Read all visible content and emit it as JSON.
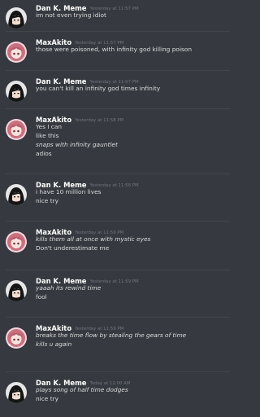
{
  "messages": [
    {
      "author": "Dan K. Meme",
      "avatar": "dan-avatar",
      "timestamp": "Yesterday at 11:57 PM",
      "lines": [
        {
          "text": "im not even trying idiot",
          "italic": false
        }
      ]
    },
    {
      "author": "MaxAkito",
      "avatar": "max-avatar",
      "timestamp": "Yesterday at 11:57 PM",
      "lines": [
        {
          "text": "those were poisoned, with infinity god killing poison",
          "italic": false
        }
      ]
    },
    {
      "author": "Dan K. Meme",
      "avatar": "dan-avatar",
      "timestamp": "Yesterday at 11:57 PM",
      "lines": [
        {
          "text": "you can't kill an infinity god times infinity",
          "italic": false
        }
      ]
    },
    {
      "author": "MaxAkito",
      "avatar": "max-avatar",
      "timestamp": "Yesterday at 11:58 PM",
      "lines": [
        {
          "text": "Yes I can",
          "italic": false
        },
        {
          "text": "like this",
          "italic": false
        },
        {
          "text": "snaps with infinity gauntlet",
          "italic": true
        },
        {
          "text": "adios",
          "italic": false
        }
      ]
    },
    {
      "author": "Dan K. Meme",
      "avatar": "dan-avatar",
      "timestamp": "Yesterday at 11:58 PM",
      "lines": [
        {
          "text": "i have 10 million lives",
          "italic": false
        },
        {
          "text": "nice try",
          "italic": false
        }
      ]
    },
    {
      "author": "MaxAkito",
      "avatar": "max-avatar",
      "timestamp": "Yesterday at 11:59 PM",
      "lines": [
        {
          "text": "kills them all at once with mystic eyes",
          "italic": true
        },
        {
          "text": "Don't underestimate me",
          "italic": false
        }
      ]
    },
    {
      "author": "Dan K. Meme",
      "avatar": "dan-avatar",
      "timestamp": "Yesterday at 11:59 PM",
      "lines": [
        {
          "text": "yaaah its rewind time",
          "italic": true
        },
        {
          "text": "fool",
          "italic": false
        }
      ]
    },
    {
      "author": "MaxAkito",
      "avatar": "max-avatar",
      "timestamp": "Yesterday at 11:59 PM",
      "lines": [
        {
          "text": "breaks the time flow by stealing the gears of time",
          "italic": true
        },
        {
          "text": "kills u again",
          "italic": true
        }
      ]
    },
    {
      "author": "Dan K. Meme",
      "avatar": "dan-avatar",
      "timestamp": "Today at 12:00 AM",
      "lines": [
        {
          "text": "plays song of half time dodges",
          "italic": true
        },
        {
          "text": "nice try",
          "italic": false
        }
      ]
    }
  ],
  "colors": {
    "background": "#36393f",
    "author": "#ffffff",
    "timestamp": "#72767d",
    "text": "#dcddde"
  }
}
